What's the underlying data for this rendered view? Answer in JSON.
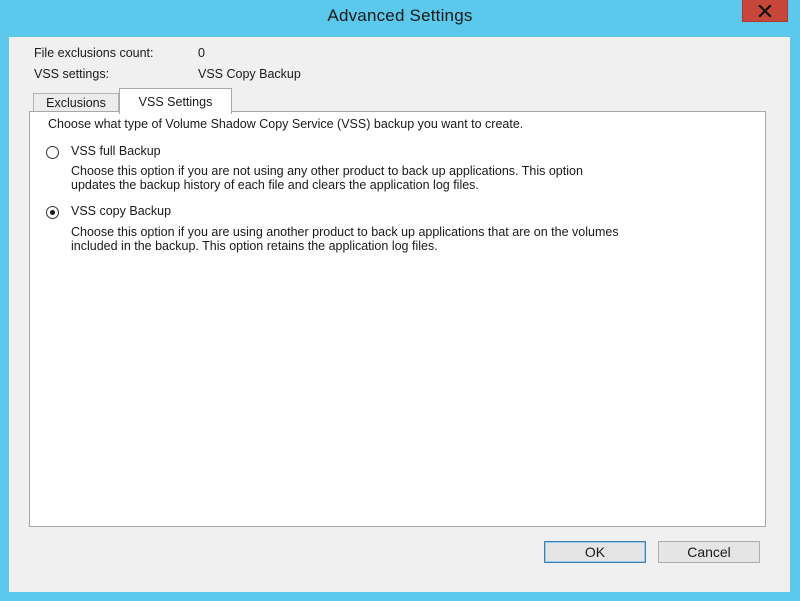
{
  "window": {
    "title": "Advanced Settings"
  },
  "info": {
    "exclusions_label": "File exclusions count:",
    "exclusions_value": "0",
    "vss_label": "VSS settings:",
    "vss_value": "VSS Copy Backup"
  },
  "tabs": [
    {
      "label": "Exclusions",
      "selected": false
    },
    {
      "label": "VSS Settings",
      "selected": true
    }
  ],
  "vss_panel": {
    "prompt": "Choose what type of Volume Shadow Copy Service (VSS) backup you want to create.",
    "options": [
      {
        "label": "VSS full Backup",
        "selected": false,
        "description_line1": "Choose this option if you are not using any other product to back up applications. This option",
        "description_line2": "updates the backup history of each file and clears the application log files."
      },
      {
        "label": "VSS copy Backup",
        "selected": true,
        "description_line1": "Choose this option if you are using another product to back up applications that are on the volumes",
        "description_line2": "included in the backup. This option retains the application log files."
      }
    ]
  },
  "buttons": {
    "ok": "OK",
    "cancel": "Cancel"
  },
  "icons": {
    "close": "close-icon"
  },
  "colors": {
    "frame": "#5bc8ec",
    "close_button": "#c7463a",
    "client_background": "#f0f0f0"
  }
}
